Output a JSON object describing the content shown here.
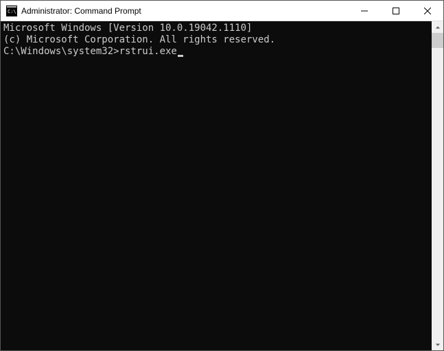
{
  "window": {
    "title": "Administrator: Command Prompt"
  },
  "terminal": {
    "line1": "Microsoft Windows [Version 10.0.19042.1110]",
    "line2": "(c) Microsoft Corporation. All rights reserved.",
    "blank": "",
    "prompt": "C:\\Windows\\system32>",
    "command": "rstrui.exe"
  }
}
